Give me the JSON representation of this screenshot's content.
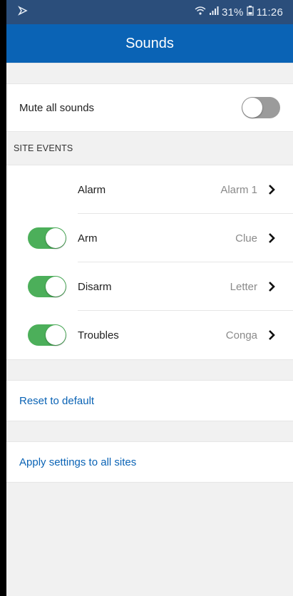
{
  "status_bar": {
    "notification_icon": "cast-icon",
    "battery_percent": "31%",
    "time": "11:26"
  },
  "header": {
    "title": "Sounds"
  },
  "mute": {
    "label": "Mute all sounds",
    "enabled": false
  },
  "site_events": {
    "header": "SITE EVENTS",
    "items": [
      {
        "name": "Alarm",
        "value": "Alarm 1",
        "has_toggle": false
      },
      {
        "name": "Arm",
        "value": "Clue",
        "has_toggle": true,
        "enabled": true
      },
      {
        "name": "Disarm",
        "value": "Letter",
        "has_toggle": true,
        "enabled": true
      },
      {
        "name": "Troubles",
        "value": "Conga",
        "has_toggle": true,
        "enabled": true
      }
    ]
  },
  "actions": {
    "reset_label": "Reset to default",
    "apply_label": "Apply settings to all sites"
  },
  "colors": {
    "primary": "#0a63b5",
    "status_bar": "#2b4e7b",
    "toggle_on": "#4caf5a",
    "toggle_off": "#9b9b9b"
  }
}
